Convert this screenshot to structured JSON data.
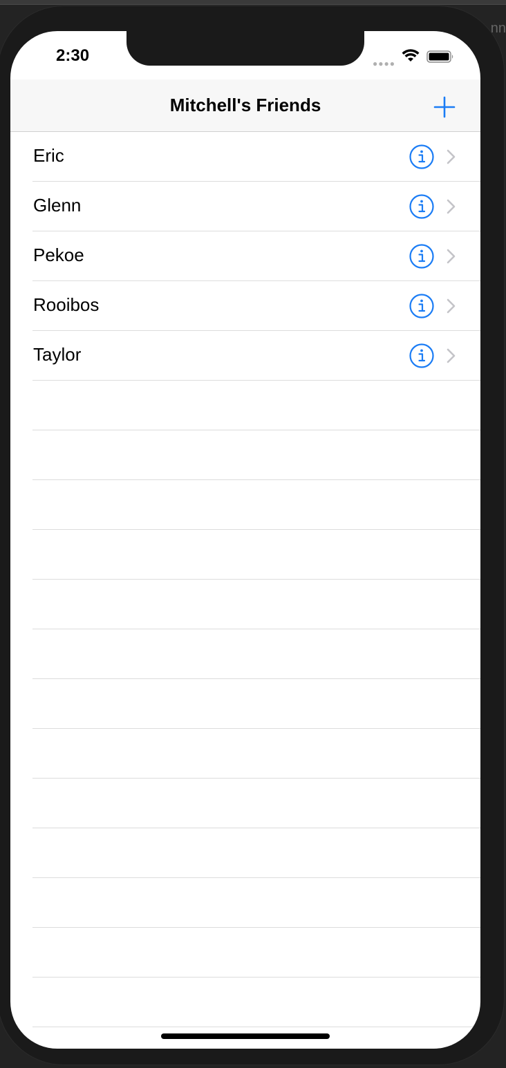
{
  "status_bar": {
    "time": "2:30",
    "signal_icon": "cellular-dots-icon",
    "wifi_icon": "wifi-icon",
    "battery_icon": "battery-icon"
  },
  "nav": {
    "title": "Mitchell's Friends",
    "add_icon": "plus-icon"
  },
  "friends": [
    {
      "name": "Eric"
    },
    {
      "name": "Glenn"
    },
    {
      "name": "Pekoe"
    },
    {
      "name": "Rooibos"
    },
    {
      "name": "Taylor"
    }
  ],
  "row_icons": {
    "info": "info-circle-icon",
    "disclosure": "chevron-right-icon"
  },
  "colors": {
    "accent": "#1a7cf5",
    "chevron": "#c4c4c8",
    "separator": "#dcdcdc",
    "nav_background": "#f7f7f7"
  },
  "desktop": {
    "corner_text": "nn"
  }
}
